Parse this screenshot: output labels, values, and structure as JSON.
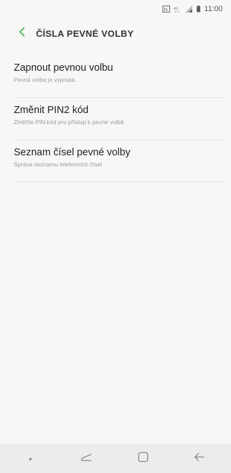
{
  "status_bar": {
    "time": "11:00"
  },
  "header": {
    "title": "ČÍSLA PEVNÉ VOLBY",
    "accent_color": "#5cb85c"
  },
  "items": [
    {
      "title": "Zapnout pevnou volbu",
      "subtitle": "Pevná volba je vypnutá."
    },
    {
      "title": "Změnit PIN2 kód",
      "subtitle": "Změňte PIN kód pro přístup k pevné volbě"
    },
    {
      "title": "Seznam čísel pevné volby",
      "subtitle": "Správa seznamu telefonních čísel"
    }
  ],
  "nav_bar": {
    "buttons": [
      "dot-icon",
      "recent-apps-icon",
      "home-icon",
      "back-arrow-icon"
    ]
  }
}
